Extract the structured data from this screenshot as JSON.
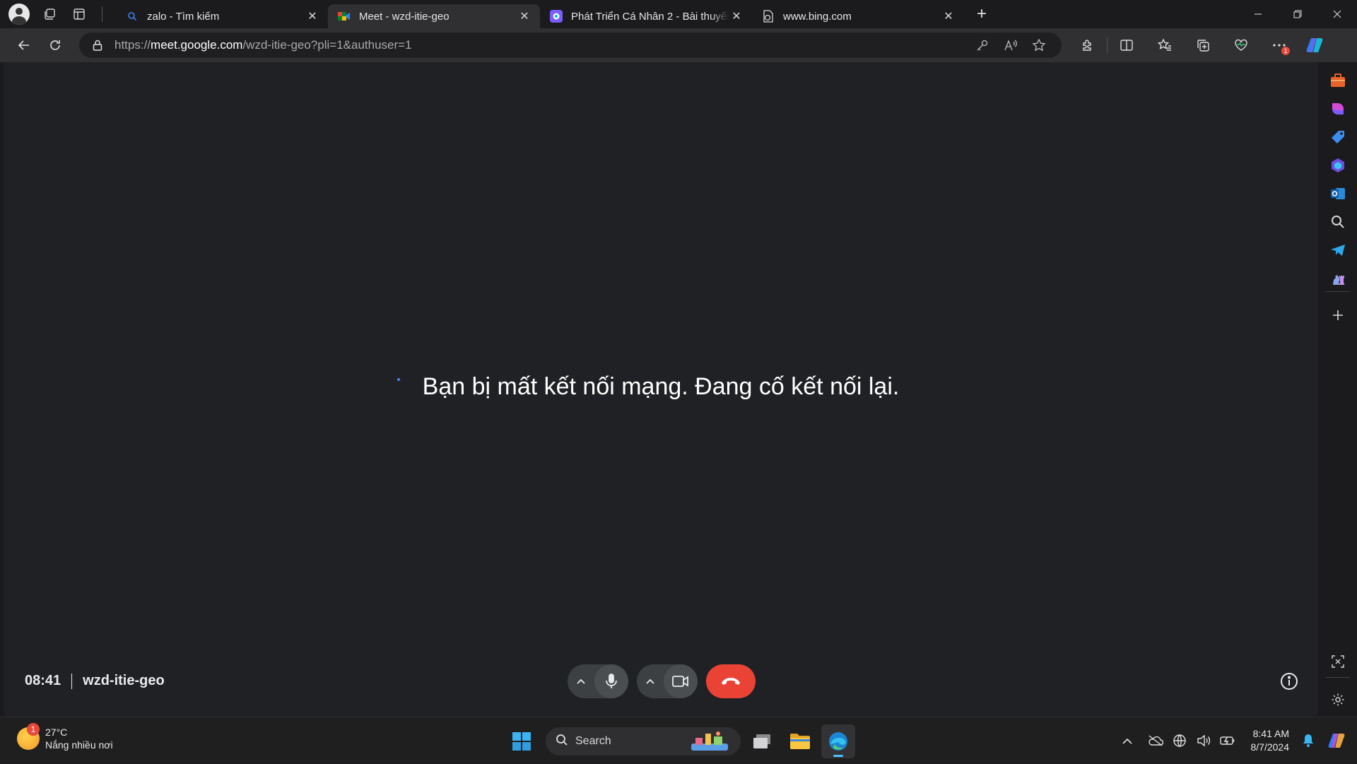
{
  "browser": {
    "tabs": [
      {
        "title": "zalo - Tìm kiếm",
        "favicon": "search-favicon",
        "active": false
      },
      {
        "title": "Meet - wzd-itie-geo",
        "favicon": "google-meet-favicon",
        "active": true
      },
      {
        "title": "Phát Triển Cá Nhân 2 - Bài thuyết",
        "favicon": "app-favicon",
        "active": false
      },
      {
        "title": "www.bing.com",
        "favicon": "page-favicon",
        "active": false
      }
    ],
    "address": {
      "prefix": "https://",
      "host": "meet.google.com",
      "path": "/wzd-itie-geo?pli=1&authuser=1"
    },
    "more_badge": "1"
  },
  "meet": {
    "status_message": "Bạn bị mất kết nối mạng. Đang cố kết nối lại.",
    "time": "08:41",
    "meeting_code": "wzd-itie-geo",
    "hangup_color": "#ea4335"
  },
  "taskbar": {
    "weather": {
      "temp": "27°C",
      "condition": "Nắng nhiều nơi",
      "badge": "1"
    },
    "search_label": "Search",
    "clock": {
      "time": "8:41 AM",
      "date": "8/7/2024"
    }
  }
}
